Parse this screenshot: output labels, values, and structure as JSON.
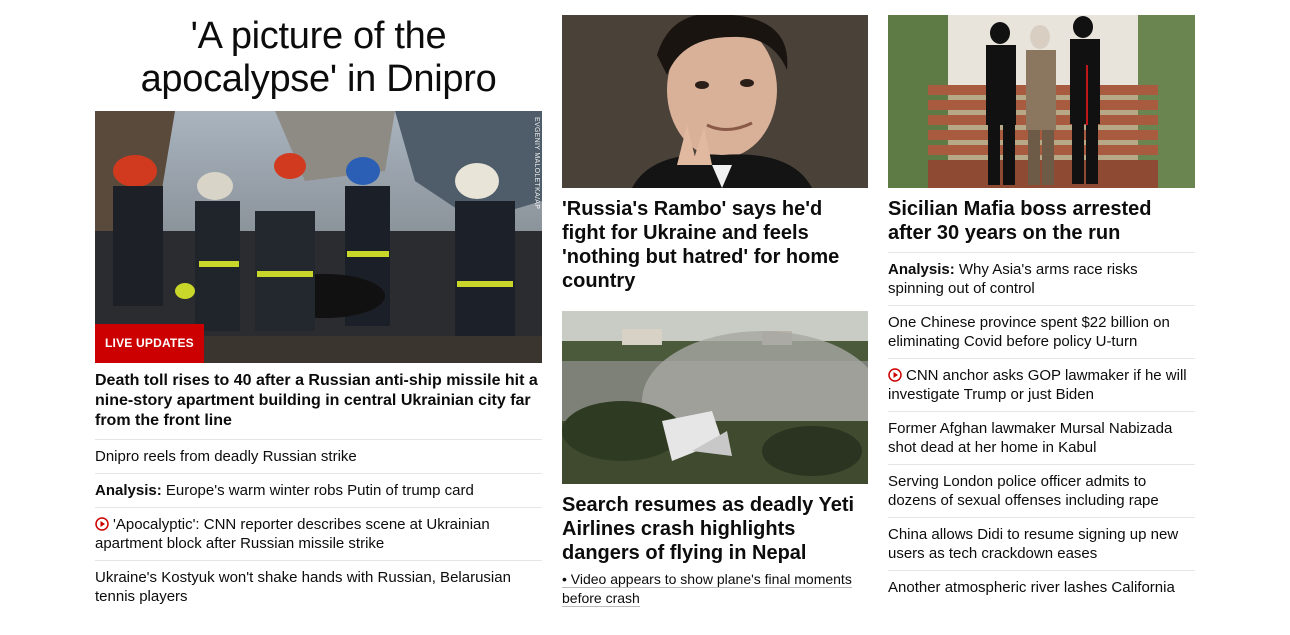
{
  "col1": {
    "title": "'A picture of the apocalypse' in Dnipro",
    "image_badge": "LIVE UPDATES",
    "image_credit": "EVGENIY MALOLETKA/AP",
    "headline": "Death toll rises to 40 after a Russian anti-ship missile hit a nine-story apartment building in central Ukrainian city far from the front line",
    "links": [
      {
        "prefix": "",
        "text": "Dnipro reels from deadly Russian strike",
        "video": false
      },
      {
        "prefix": "Analysis:",
        "text": " Europe's warm winter robs Putin of trump card",
        "video": false
      },
      {
        "prefix": "",
        "text": "'Apocalyptic': CNN reporter describes scene at Ukrainian apartment block after Russian missile strike",
        "video": true
      },
      {
        "prefix": "",
        "text": "Ukraine's Kostyuk won't shake hands with Russian, Belarusian tennis players",
        "video": false
      }
    ]
  },
  "col2": {
    "story1_headline": "'Russia's Rambo' says he'd fight for Ukraine and feels 'nothing but hatred' for home country",
    "story2_headline": "Search resumes as deadly Yeti Airlines crash highlights dangers of flying in Nepal",
    "story2_sublink": "• Video appears to show plane's final moments before crash"
  },
  "col3": {
    "headline": "Sicilian Mafia boss arrested after 30 years on the run",
    "links": [
      {
        "prefix": "Analysis:",
        "text": " Why Asia's arms race risks spinning out of control",
        "video": false
      },
      {
        "prefix": "",
        "text": "One Chinese province spent $22 billion on eliminating Covid before policy U-turn",
        "video": false
      },
      {
        "prefix": "",
        "text": "CNN anchor asks GOP lawmaker if he will investigate Trump or just Biden",
        "video": true
      },
      {
        "prefix": "",
        "text": "Former Afghan lawmaker Mursal Nabizada shot dead at her home in Kabul",
        "video": false
      },
      {
        "prefix": "",
        "text": "Serving London police officer admits to dozens of sexual offenses including rape",
        "video": false
      },
      {
        "prefix": "",
        "text": "China allows Didi to resume signing up new users as tech crackdown eases",
        "video": false
      },
      {
        "prefix": "",
        "text": "Another atmospheric river lashes California",
        "video": false
      }
    ]
  },
  "colors": {
    "accent_red": "#cc0000",
    "divider": "#e6e6e6",
    "text": "#0c0c0c"
  },
  "icons": {
    "video": "play-circle-icon"
  }
}
